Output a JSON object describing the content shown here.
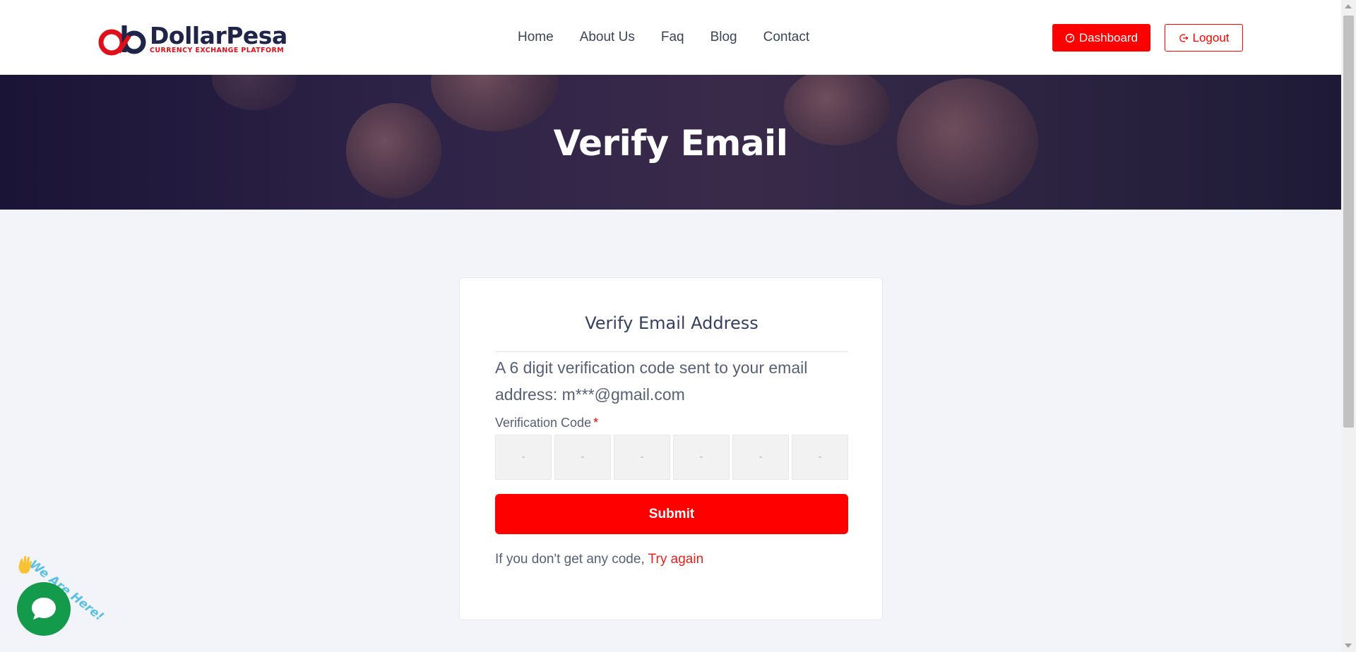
{
  "header": {
    "logo_name": "DollarPesa",
    "logo_tagline": "CURRENCY EXCHANGE PLATFORM",
    "nav": [
      {
        "label": "Home"
      },
      {
        "label": "About Us"
      },
      {
        "label": "Faq"
      },
      {
        "label": "Blog"
      },
      {
        "label": "Contact"
      }
    ],
    "dashboard_label": "Dashboard",
    "logout_label": "Logout",
    "dashboard_icon": "gauge-icon",
    "logout_icon": "logout-icon"
  },
  "banner": {
    "title": "Verify Email"
  },
  "card": {
    "title": "Verify Email Address",
    "description": "A 6 digit verification code sent to your email address: m***@gmail.com",
    "code_label": "Verification Code",
    "required_mark": "*",
    "code_placeholders": [
      "-",
      "-",
      "-",
      "-",
      "-",
      "-"
    ],
    "submit_label": "Submit",
    "resend_text": "If you don't get any code,",
    "resend_link": "Try again"
  },
  "chat_widget": {
    "tagline": "We Are Here!",
    "icon": "chat-bubble-icon"
  },
  "colors": {
    "accent": "#ff0000",
    "brand_navy": "#1f2448",
    "chat_green": "#149a4b"
  }
}
